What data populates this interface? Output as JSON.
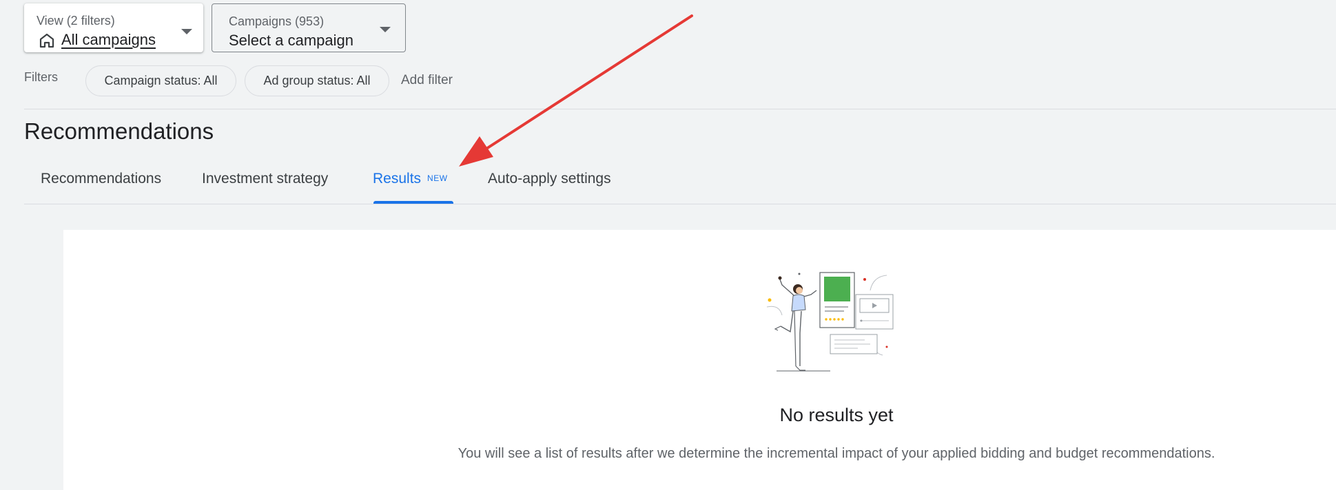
{
  "view_selector": {
    "label": "View (2 filters)",
    "value": "All campaigns",
    "icon": "home-icon"
  },
  "campaign_selector": {
    "label": "Campaigns (953)",
    "value": "Select a campaign"
  },
  "filters": {
    "label": "Filters",
    "chips": [
      "Campaign status: All",
      "Ad group status: All"
    ],
    "add_filter": "Add filter"
  },
  "page": {
    "title": "Recommendations"
  },
  "tabs": [
    {
      "label": "Recommendations"
    },
    {
      "label": "Investment strategy"
    },
    {
      "label": "Results",
      "badge": "NEW",
      "active": true
    },
    {
      "label": "Auto-apply settings"
    }
  ],
  "empty_state": {
    "title": "No results yet",
    "description": "You will see a list of results after we determine the incremental impact of your applied bidding and budget recommendations."
  },
  "colors": {
    "accent": "#1a73e8",
    "background": "#f1f3f4",
    "annotation_arrow": "#e53935",
    "illustration_green": "#4caf50"
  }
}
